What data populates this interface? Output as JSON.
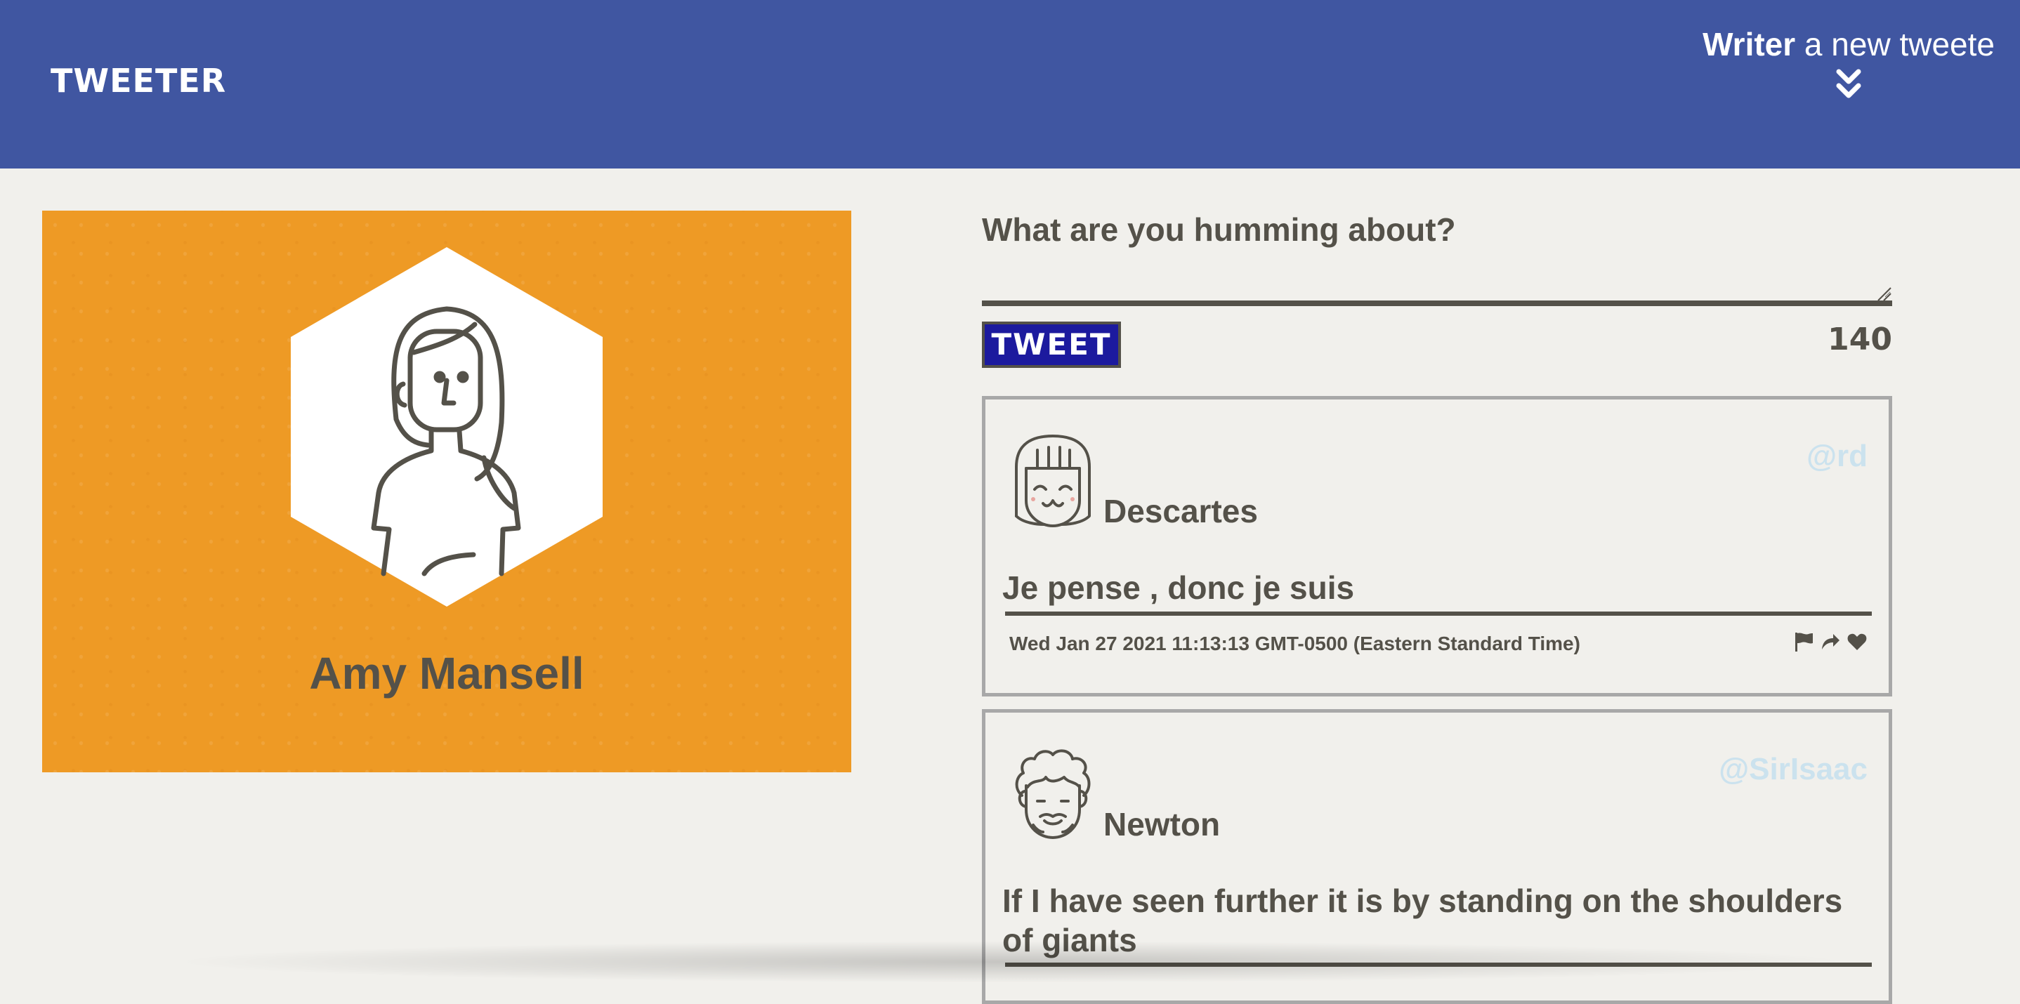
{
  "nav": {
    "brand": "TWEETER",
    "compose_bold": "Writer",
    "compose_rest": " a new tweete",
    "arrows_icon": "double-chevron-down-icon"
  },
  "profile": {
    "name": "Amy Mansell",
    "background_color": "#ee9a25"
  },
  "compose": {
    "title": "What are you humming about?",
    "textarea_value": "",
    "button_label": "TWEET",
    "counter": "140"
  },
  "tweets": [
    {
      "name": "Descartes",
      "handle": "@rd",
      "body": "Je pense , donc je suis",
      "date": "Wed Jan 27 2021 11:13:13 GMT-0500 (Eastern Standard Time)",
      "actions": [
        "flag-icon",
        "retweet-icon",
        "heart-icon"
      ]
    },
    {
      "name": "Newton",
      "handle": "@SirIsaac",
      "body": "If I have seen further it is by standing on the shoulders of giants"
    }
  ],
  "colors": {
    "nav": "#4056a1",
    "background": "#f1f0ec",
    "text": "#545149",
    "button": "#1c1a9e",
    "handle": "#cbe2ee"
  }
}
